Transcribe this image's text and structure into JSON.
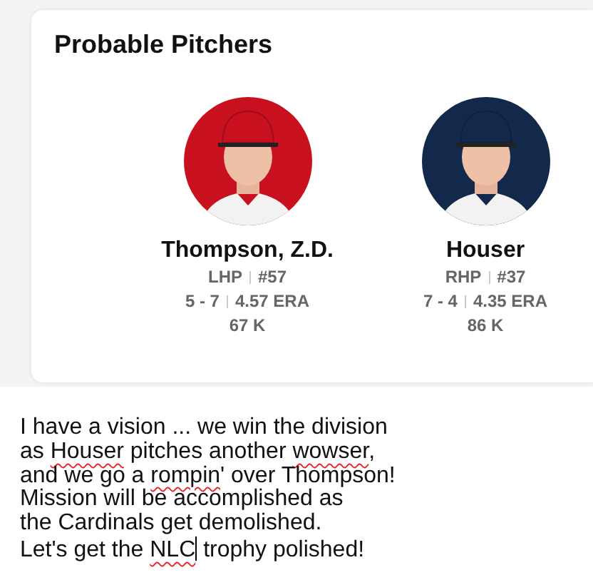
{
  "card": {
    "title": "Probable Pitchers",
    "pitchers": [
      {
        "name": "Thompson, Z.D.",
        "hand": "LHP",
        "number": "#57",
        "record": "5 - 7",
        "era": "4.57 ERA",
        "strikeouts": "67 K"
      },
      {
        "name": "Houser",
        "hand": "RHP",
        "number": "#37",
        "record": "7 - 4",
        "era": "4.35 ERA",
        "strikeouts": "86 K"
      }
    ]
  },
  "editor": {
    "lines": [
      [
        {
          "text": "I have a vision ... we win the division",
          "misspelled": false
        }
      ],
      [
        {
          "text": "as ",
          "misspelled": false
        },
        {
          "text": "Houser",
          "misspelled": true
        },
        {
          "text": " pitches another ",
          "misspelled": false
        },
        {
          "text": "wowser",
          "misspelled": true
        },
        {
          "text": ",",
          "misspelled": false
        }
      ],
      [
        {
          "text": "and we go a ",
          "misspelled": false
        },
        {
          "text": "rompin",
          "misspelled": true
        },
        {
          "text": "' over Thompson!",
          "misspelled": false
        }
      ],
      [
        {
          "text": "Mission will be accomplished as",
          "misspelled": false
        }
      ],
      [
        {
          "text": "the Cardinals get demolished.",
          "misspelled": false
        }
      ],
      [
        {
          "text": "Let's get the ",
          "misspelled": false
        },
        {
          "text": "NLC",
          "misspelled": true,
          "cursor_after": true
        },
        {
          "text": " trophy polished!",
          "misspelled": false
        }
      ]
    ]
  }
}
